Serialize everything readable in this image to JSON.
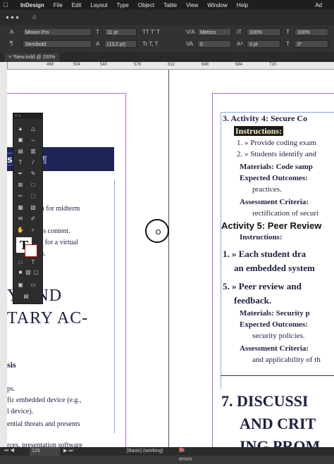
{
  "menubar": {
    "items": [
      "InDesign",
      "File",
      "Edit",
      "Layout",
      "Type",
      "Object",
      "Table",
      "View",
      "Window",
      "Help"
    ],
    "right_text": "Ad"
  },
  "control_panel": {
    "font_family": "Minion Pro",
    "font_style": "Semibold",
    "font_size": "11 pt",
    "leading": "(13.2 pt)",
    "kerning": "Metrics",
    "vertical_scale": "100%",
    "horizontal_scale": "100%",
    "tracking": "0",
    "baseline_shift": "0 pt",
    "skew": "0°"
  },
  "document_tab": {
    "label": "*New.indd @ 200%"
  },
  "ruler": {
    "ticks": [
      "468",
      "504",
      "540",
      "576",
      "612",
      "648",
      "684",
      "720"
    ]
  },
  "left_page": {
    "heading_bar": "ssment",
    "lines": [
      "ion for midterm",
      "ek's content.",
      "rm for a virtual",
      "ess."
    ],
    "big_heading": [
      "Y AND",
      "TARY AC-"
    ],
    "subheading": "sis",
    "body": [
      "ps.",
      "fic embedded device (e.g.,",
      "l device).",
      "ential threats and presents",
      "rces, presentation software"
    ]
  },
  "right_page": {
    "activity4": "3. Activity 4: Secure Co",
    "instructions_label": "Instructions:",
    "items": [
      "1. » Provide coding exam",
      "2. » Students identify and"
    ],
    "materials": "Materials: Code samp",
    "expected": "Expected Outcomes:",
    "expected_cont": "practices.",
    "assessment": "Assessment Criteria:",
    "assessment_cont": "rectification of securi",
    "activity5": "Activity 5: Peer Review",
    "instructions2": "Instructions:",
    "step1": "1. » Each student dra",
    "step1_cont": "an embedded system",
    "step2": "5. » Peer review and",
    "step2_cont": "feedback.",
    "materials2": "Materials: Security p",
    "expected2": "Expected Outcomes:",
    "expected2_cont": "security policies.",
    "assessment2": "Assessment Criteria:",
    "assessment2_cont": "and applicability of th",
    "section7": [
      "7. DISCUSSI",
      "AND CRIT",
      "ING PROM"
    ]
  },
  "statusbar": {
    "page": "129",
    "style": "[Basic] (working)",
    "errors": "28 errors"
  },
  "colors": {
    "heading_bar": "#1f2456",
    "margin_guide": "#b26ad6",
    "pilcrow": "#4a6ad6",
    "error": "#e03b3b"
  }
}
